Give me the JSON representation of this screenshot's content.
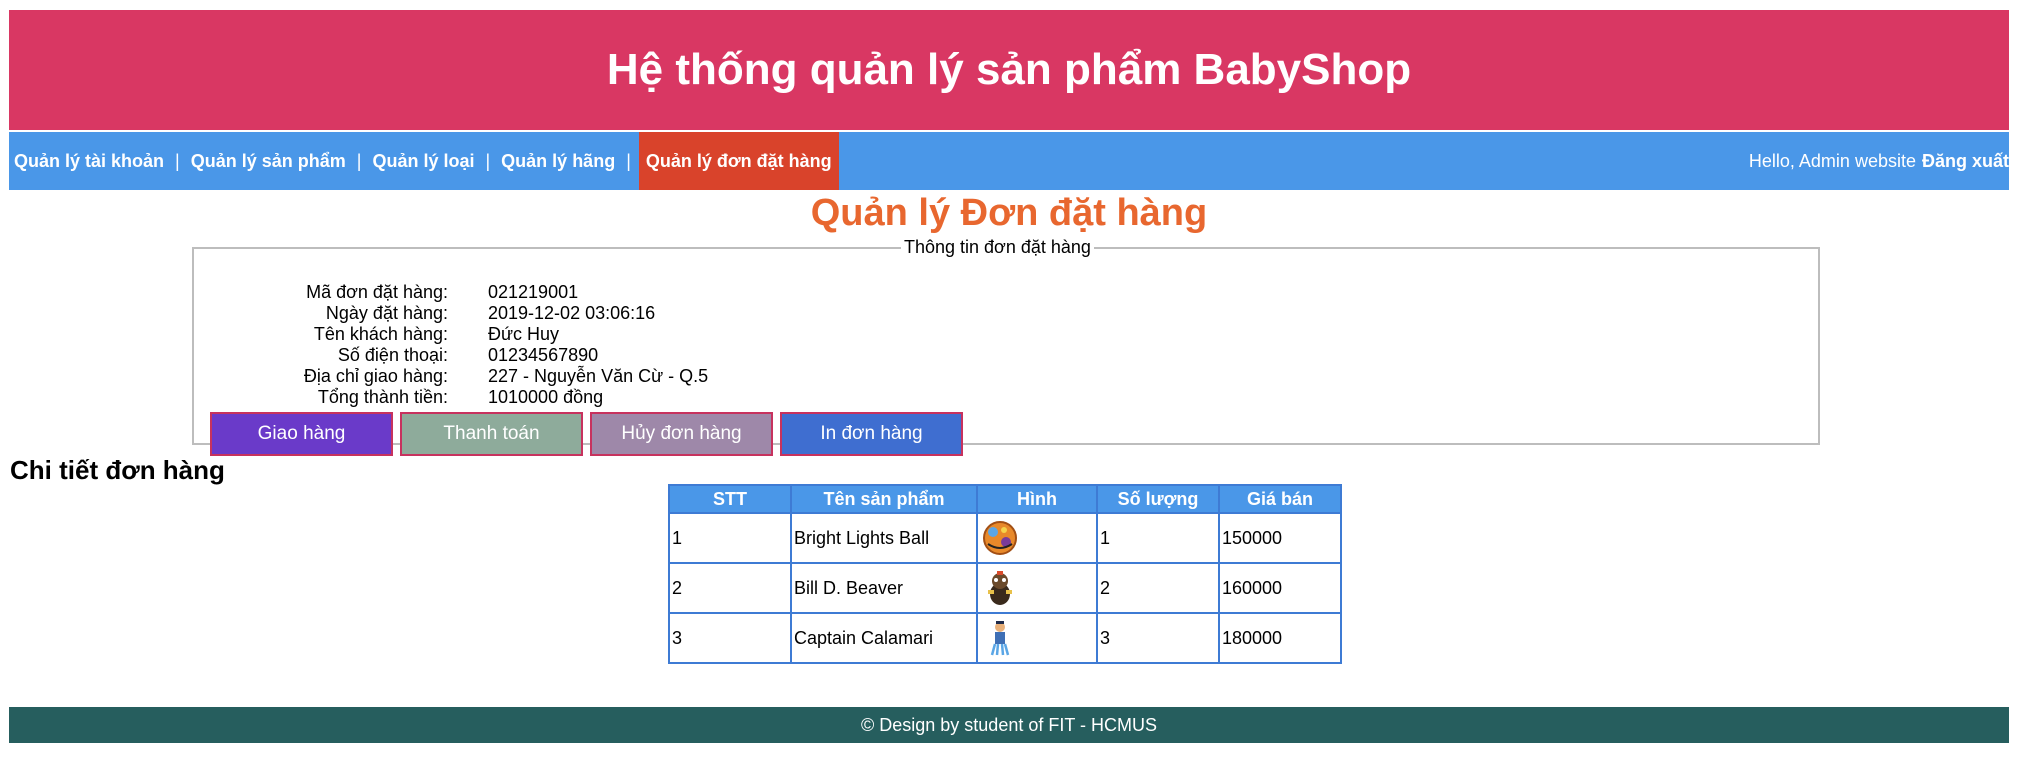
{
  "header": {
    "title": "Hệ thống quản lý sản phẩm BabyShop"
  },
  "nav": {
    "items": [
      {
        "label": "Quản lý tài khoản",
        "active": false
      },
      {
        "label": "Quản lý sản phẩm",
        "active": false
      },
      {
        "label": "Quản lý loại",
        "active": false
      },
      {
        "label": "Quản lý hãng",
        "active": false
      },
      {
        "label": "Quản lý đơn đặt hàng",
        "active": true
      }
    ],
    "separator": "|",
    "greeting": "Hello, Admin website",
    "logout": "Đăng xuất"
  },
  "page": {
    "title": "Quản lý Đơn đặt hàng"
  },
  "order": {
    "legend": "Thông tin đơn đặt hàng",
    "fields": [
      {
        "label": "Mã đơn đặt hàng:",
        "value": "021219001"
      },
      {
        "label": "Ngày đặt hàng:",
        "value": "2019-12-02 03:06:16"
      },
      {
        "label": "Tên khách hàng:",
        "value": "Đức Huy"
      },
      {
        "label": "Số điện thoại:",
        "value": "01234567890"
      },
      {
        "label": "Địa chỉ giao hàng:",
        "value": "227 - Nguyễn Văn Cừ - Q.5"
      },
      {
        "label": "Tổng thành tiền:",
        "value": "1010000 đồng"
      }
    ],
    "buttons": {
      "ship": "Giao hàng",
      "pay": "Thanh toán",
      "cancel": "Hủy đơn hàng",
      "print": "In đơn hàng"
    }
  },
  "detail": {
    "heading": "Chi tiết đơn hàng",
    "columns": [
      "STT",
      "Tên sản phẩm",
      "Hình",
      "Số lượng",
      "Giá bán"
    ],
    "rows": [
      {
        "stt": "1",
        "name": "Bright Lights Ball",
        "image_icon": "ball-toy-icon",
        "qty": "1",
        "price": "150000"
      },
      {
        "stt": "2",
        "name": "Bill D. Beaver",
        "image_icon": "beaver-toy-icon",
        "qty": "2",
        "price": "160000"
      },
      {
        "stt": "3",
        "name": "Captain Calamari",
        "image_icon": "calamari-toy-icon",
        "qty": "3",
        "price": "180000"
      }
    ]
  },
  "footer": {
    "text": "© Design by student of FIT - HCMUS"
  },
  "colors": {
    "header_bg": "#d93763",
    "nav_bg": "#4a97e8",
    "nav_active_bg": "#d9432b",
    "title": "#e8672f",
    "footer_bg": "#265e5e"
  }
}
